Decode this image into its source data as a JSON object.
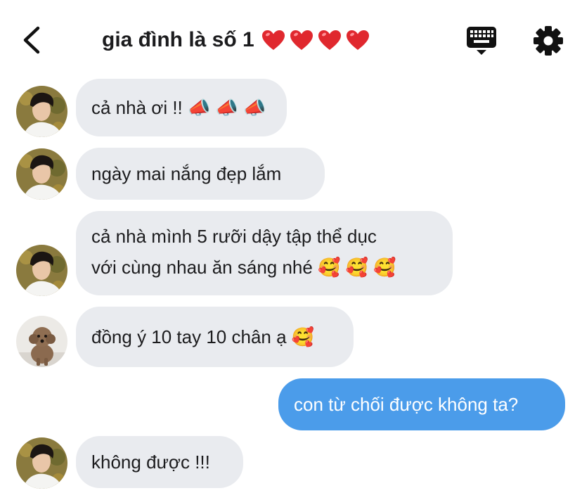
{
  "header": {
    "title": "gia đình là số 1",
    "title_hearts": [
      "❤️",
      "❤️",
      "❤️",
      "❤️"
    ],
    "icons": {
      "back": "chevron-left-icon",
      "keyboard": "keyboard-icon",
      "settings": "gear-icon"
    }
  },
  "colors": {
    "incoming_bubble": "#e9ebef",
    "outgoing_bubble": "#4b9cea",
    "heart": "#e0282e"
  },
  "messages": [
    {
      "sender": "boy",
      "lines": [
        "cả nhà ơi !! 📣 📣 📣"
      ]
    },
    {
      "sender": "boy",
      "lines": [
        "ngày mai nắng đẹp lắm"
      ]
    },
    {
      "sender": "boy",
      "lines": [
        "cả nhà mình 5 rưỡi dậy tập thể dục",
        "với cùng nhau ăn sáng nhé 🥰 🥰 🥰"
      ]
    },
    {
      "sender": "dog",
      "lines": [
        "đồng ý 10 tay 10 chân ạ 🥰"
      ]
    },
    {
      "sender": "me",
      "lines": [
        "con từ chối được không ta?"
      ]
    },
    {
      "sender": "boy",
      "lines": [
        "không được !!!"
      ]
    }
  ]
}
